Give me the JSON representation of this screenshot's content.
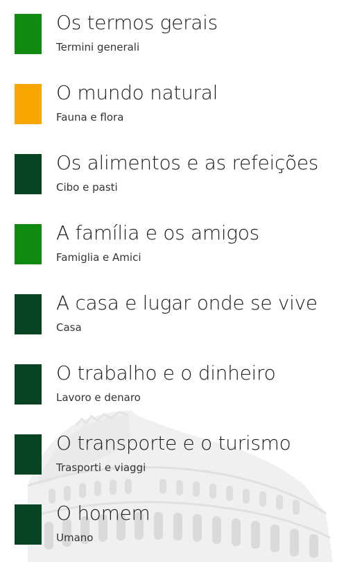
{
  "colors": {
    "green": "#118a11",
    "orange": "#f9a600",
    "dark_green": "#084322",
    "text": "#1a1a1a",
    "subtext": "#333333"
  },
  "categories": [
    {
      "title": "Os termos gerais",
      "subtitle": "Termini generali",
      "color": "#118a11"
    },
    {
      "title": "O mundo natural",
      "subtitle": "Fauna e flora",
      "color": "#f9a600"
    },
    {
      "title": "Os alimentos e as refeições",
      "subtitle": "Cibo e pasti",
      "color": "#084322"
    },
    {
      "title": "A família e os amigos",
      "subtitle": "Famiglia e Amici",
      "color": "#118a11"
    },
    {
      "title": "A casa e lugar onde se vive",
      "subtitle": "Casa",
      "color": "#084322"
    },
    {
      "title": "O trabalho e o dinheiro",
      "subtitle": "Lavoro e denaro",
      "color": "#084322"
    },
    {
      "title": "O transporte e o turismo",
      "subtitle": "Trasporti e viaggi",
      "color": "#084322"
    },
    {
      "title": "O homem",
      "subtitle": "Umano",
      "color": "#084322"
    }
  ],
  "background": {
    "image": "colosseum-watermark"
  }
}
